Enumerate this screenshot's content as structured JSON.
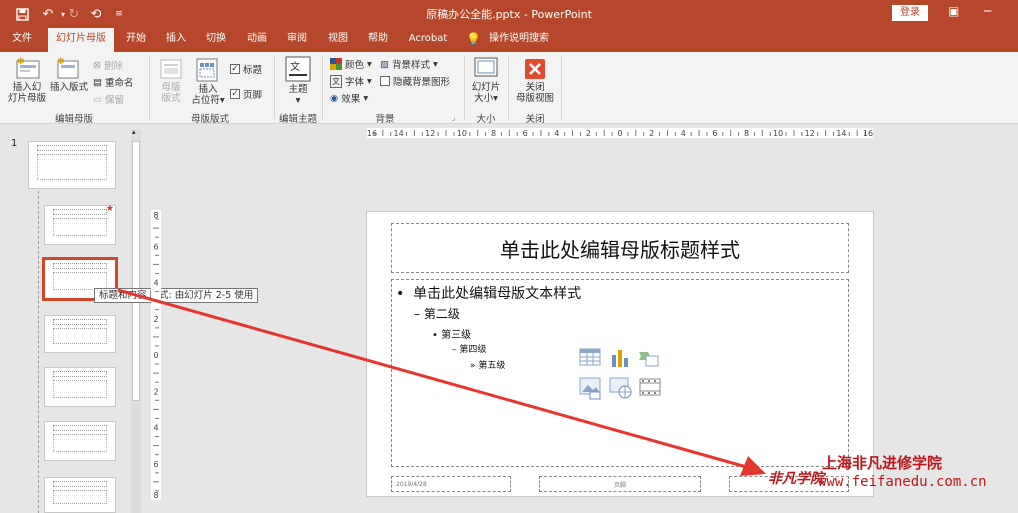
{
  "window": {
    "title": "原稿办公全能.pptx  -  PowerPoint",
    "login_label": "登录"
  },
  "tabs": [
    "文件",
    "幻灯片母版",
    "开始",
    "插入",
    "切换",
    "动画",
    "审阅",
    "视图",
    "帮助",
    "Acrobat",
    "操作说明搜索"
  ],
  "ribbon": {
    "insert_slide_master": [
      "插入幻",
      "灯片母版"
    ],
    "insert_layout": "插入版式",
    "delete": "删除",
    "rename": "重命名",
    "preserve": "保留",
    "group_edit_master": "编辑母版",
    "master_layout": [
      "母版",
      "版式"
    ],
    "insert_placeholder": [
      "插入",
      "占位符"
    ],
    "title_check": "标题",
    "footer_check": "页脚",
    "group_master_layout": "母版版式",
    "themes": "主题",
    "group_edit_theme": "编辑主题",
    "colors": "颜色",
    "fonts": "字体",
    "effects": "效果",
    "background_styles": "背景样式",
    "hide_bg_graphics": "隐藏背景图形",
    "group_background": "背景",
    "slide_size": [
      "幻灯片",
      "大小"
    ],
    "group_size": "大小",
    "close_master": [
      "关闭",
      "母版视图"
    ],
    "group_close": "关闭"
  },
  "left_panel": {
    "slide_number": "1",
    "tooltip": "标题和内容 版式: 由幻灯片 2-5 使用"
  },
  "ruler": {
    "h_labels": [
      "16",
      "14",
      "12",
      "10",
      "8",
      "6",
      "4",
      "2",
      "0",
      "2",
      "4",
      "6",
      "8",
      "10",
      "12",
      "14",
      "16"
    ],
    "v_labels": [
      "8",
      "6",
      "4",
      "2",
      "0",
      "2",
      "4",
      "6",
      "8"
    ]
  },
  "slide": {
    "title": "单击此处编辑母版标题样式",
    "level1": "单击此处编辑母版文本样式",
    "level2": "第二级",
    "level3": "第三级",
    "level4": "第四级",
    "level5": "第五级",
    "date": "2019/4/28",
    "footer": "页脚"
  },
  "watermark": {
    "line1": "上海非凡进修学院",
    "line2": "www.feifanedu.com.cn",
    "logo": "非凡学院"
  },
  "colors": {
    "accent": "#b7472a",
    "arrow": "#e8352b"
  }
}
